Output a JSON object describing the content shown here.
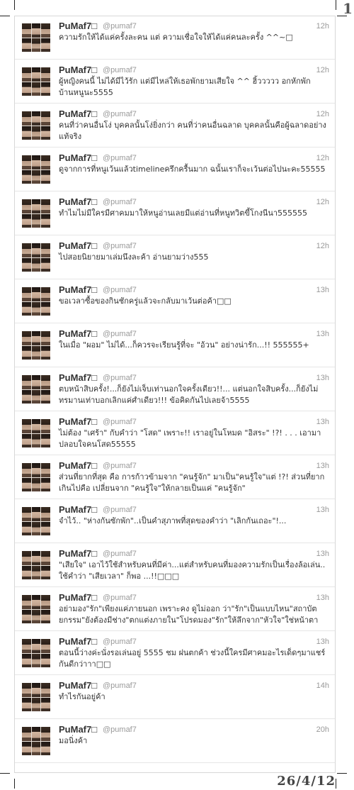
{
  "page_number": "1",
  "date_stamp": "26/4/12",
  "tweets": [
    {
      "name": "PuMaf7□",
      "handle": "@pumaf7",
      "time": "12h",
      "text": "ความรักให้ได้แค่ครั้งละคน แต่ ความเชื่อใจให้ได้แค่คนละครั้ง ^^~□"
    },
    {
      "name": "PuMaf7□",
      "handle": "@pumaf7",
      "time": "12h",
      "text": "ผู้หญิงคนนี้ ไม่ได้มีไว้รัก แต่มีไหล่ให้เธอพักยามเสียใจ ^^ ฮิ้ววววว อกหักพักบ้านหนูนะ5555"
    },
    {
      "name": "PuMaf7□",
      "handle": "@pumaf7",
      "time": "12h",
      "text": "คนที่ว่าคนอื่นโง่ บุคคลนั้นโง่ยิ่งกว่า คนที่ว่าคนอื่นฉลาด บุคคลนั้นคือผู้ฉลาดอย่างแท้จริง"
    },
    {
      "name": "PuMaf7□",
      "handle": "@pumaf7",
      "time": "12h",
      "text": "ดูจากการที่หนูเว้นแล้วtimelineครึกครื้นมาก ฉนั้นเราก็จะเว้นต่อไปนะคะ55555"
    },
    {
      "name": "PuMaf7□",
      "handle": "@pumaf7",
      "time": "12h",
      "text": "ทำไมไม่มีใครมีศาคมมาให้หนูอ่านเลยมีแต่อ่านที่หนูทวิตขี้โกงนีนา555555"
    },
    {
      "name": "PuMaf7□",
      "handle": "@pumaf7",
      "time": "12h",
      "text": "ไปสอยนิยายมาเล่มนึงละค้า อ่านยามว่าง555"
    },
    {
      "name": "PuMaf7□",
      "handle": "@pumaf7",
      "time": "13h",
      "text": "ขอเวลาซื้อของกินชักครู่แล้วจะกลับมาเว้นต่อค้า□□"
    },
    {
      "name": "PuMaf7□",
      "handle": "@pumaf7",
      "time": "13h",
      "text": "ในเมื่อ \"ผอม\" ไม่ได้...ก็ควรจะเรียนรู้ที่จะ \"อ้วน\" อย่างน่ารัก...!! 555555+"
    },
    {
      "name": "PuMaf7□",
      "handle": "@pumaf7",
      "time": "13h",
      "text": "ตบหน้าสิบครั้ง!...ก็ยังไม่เจ็บเท่านอกใจครั้งเดียว!!... แต่นอกใจสิบครั้ง...ก็ยังไม่ทรมานเท่าบอกเลิกแค่ศำเดียว!!! ข้อคิดกันไปเลยจ้า5555"
    },
    {
      "name": "PuMaf7□",
      "handle": "@pumaf7",
      "time": "13h",
      "text": "ไม่ต้อง \"เศร้า\" กับคำว่า \"โสด\" เพราะ!! เราอยู่ในโหมด \"อิสระ\" !?! . . . เอามาปลอบใจคนโสด55555"
    },
    {
      "name": "PuMaf7□",
      "handle": "@pumaf7",
      "time": "13h",
      "text": "ส่วนที่ยากที่สุด คือ การก้าวข้ามจาก \"คนรู้จัก\" มาเป็น\"คนรู้ใจ\"แต่ !?! ส่วนที่ยากเกินไปคือ เปลี่ยนจาก \"คนรู้ใจ\"ให้กลายเป็นแค่ \"คนรู้จัก\""
    },
    {
      "name": "PuMaf7□",
      "handle": "@pumaf7",
      "time": "13h",
      "text": "จำไว้.. \"ห่างกันซักพัก\"..เป็นคำสุภาพที่สุดของคำว่า \"เลิกกันเถอะ\"!..."
    },
    {
      "name": "PuMaf7□",
      "handle": "@pumaf7",
      "time": "13h",
      "text": "\"เสียใจ\" เอาไว้ใช้สำหรับคนที่มีค่า...แต่สำหรับคนที่มองความรักเป็นเรื่องล้อเล่น.. ใช้คำว่า \"เสียเวลา\" ก็พอ ...!!□□□"
    },
    {
      "name": "PuMaf7□",
      "handle": "@pumaf7",
      "time": "13h",
      "text": "อย่ามอง\"รัก\"เพียงแค่ภายนอก เพราะคง ดูไม่ออก ว่า\"รัก\"เป็นแบบไหน\"สถาบัตยกรรม\"ยังต้องมีช่าง\"ตกแต่งภายใน\"โปรดมอง\"รัก\"ให้ลึกจาก\"หัวใจ\"ใช่หน้าตา"
    },
    {
      "name": "PuMaf7□",
      "handle": "@pumaf7",
      "time": "13h",
      "text": "ตอนนี้ว่างค่ะนั่งรอเล่นอยู่ 5555 ชม ฝนตกค้า ช่วงนี้ใครมีศาคมอะไรเด็ดๆมาแชร์กันดีกว่าาา□□"
    },
    {
      "name": "PuMaf7□",
      "handle": "@pumaf7",
      "time": "14h",
      "text": "ทำไรกันอยู่ค้า"
    },
    {
      "name": "PuMaf7□",
      "handle": "@pumaf7",
      "time": "20h",
      "text": "มอนิ่งค้า"
    }
  ]
}
